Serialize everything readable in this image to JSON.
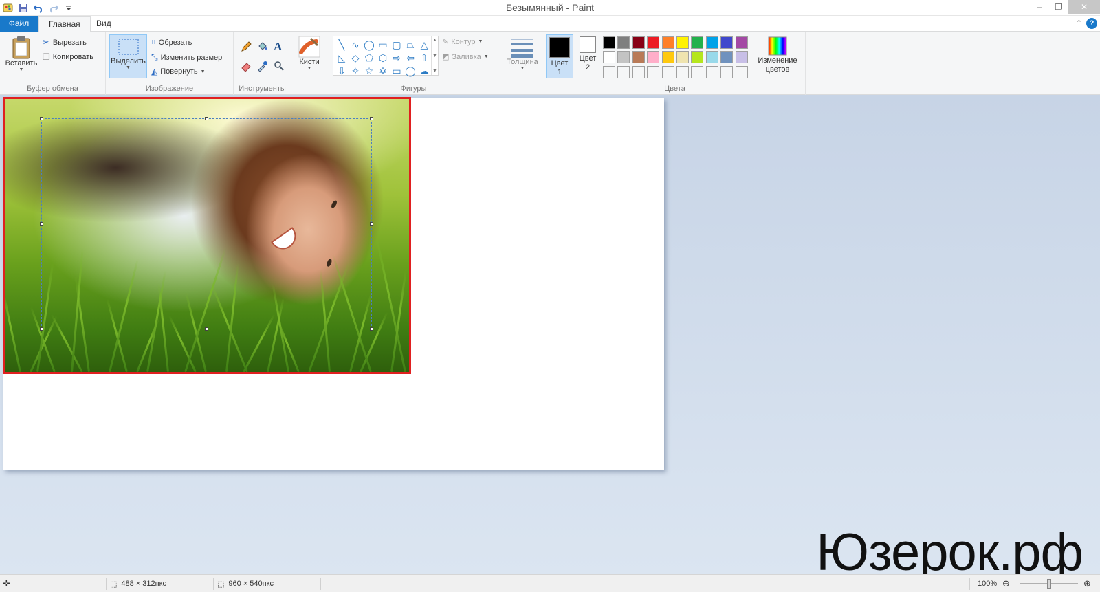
{
  "window": {
    "title": "Безымянный - Paint",
    "controls": [
      "–",
      "❐",
      "✕"
    ]
  },
  "tabs": {
    "file": "Файл",
    "home": "Главная",
    "view": "Вид",
    "help": "?"
  },
  "ribbon": {
    "clipboard": {
      "label": "Буфер обмена",
      "paste": "Вставить",
      "cut": "Вырезать",
      "copy": "Копировать"
    },
    "image": {
      "label": "Изображение",
      "select": "Выделить",
      "crop": "Обрезать",
      "resize": "Изменить размер",
      "rotate": "Повернуть"
    },
    "tools": {
      "label": "Инструменты",
      "text_glyph": "A"
    },
    "brushes": {
      "label": "Кисти"
    },
    "shapes": {
      "label": "Фигуры",
      "outline": "Контур",
      "fill": "Заливка"
    },
    "size": {
      "label": "Толщина"
    },
    "colors": {
      "label": "Цвета",
      "color1": "Цвет 1",
      "color2": "Цвет 2",
      "color1_value": "#000000",
      "color2_value": "#ffffff",
      "edit": "Изменение цветов",
      "palette": [
        "#000000",
        "#7f7f7f",
        "#880015",
        "#ed1c24",
        "#ff7f27",
        "#fff200",
        "#22b14c",
        "#00a2e8",
        "#3f48cc",
        "#a349a4",
        "#ffffff",
        "#c3c3c3",
        "#b97a57",
        "#ffaec9",
        "#ffc90e",
        "#efe4b0",
        "#b5e61d",
        "#99d9ea",
        "#7092be",
        "#c8bfe7",
        "#f5f6f7",
        "#f5f6f7",
        "#f5f6f7",
        "#f5f6f7",
        "#f5f6f7",
        "#f5f6f7",
        "#f5f6f7",
        "#f5f6f7",
        "#f5f6f7",
        "#f5f6f7"
      ]
    }
  },
  "status": {
    "selection_size": "488 × 312пкс",
    "canvas_size": "960 × 540пкс",
    "zoom": "100%",
    "zoom_level": 0.5
  },
  "watermark": "Юзерок.рф"
}
